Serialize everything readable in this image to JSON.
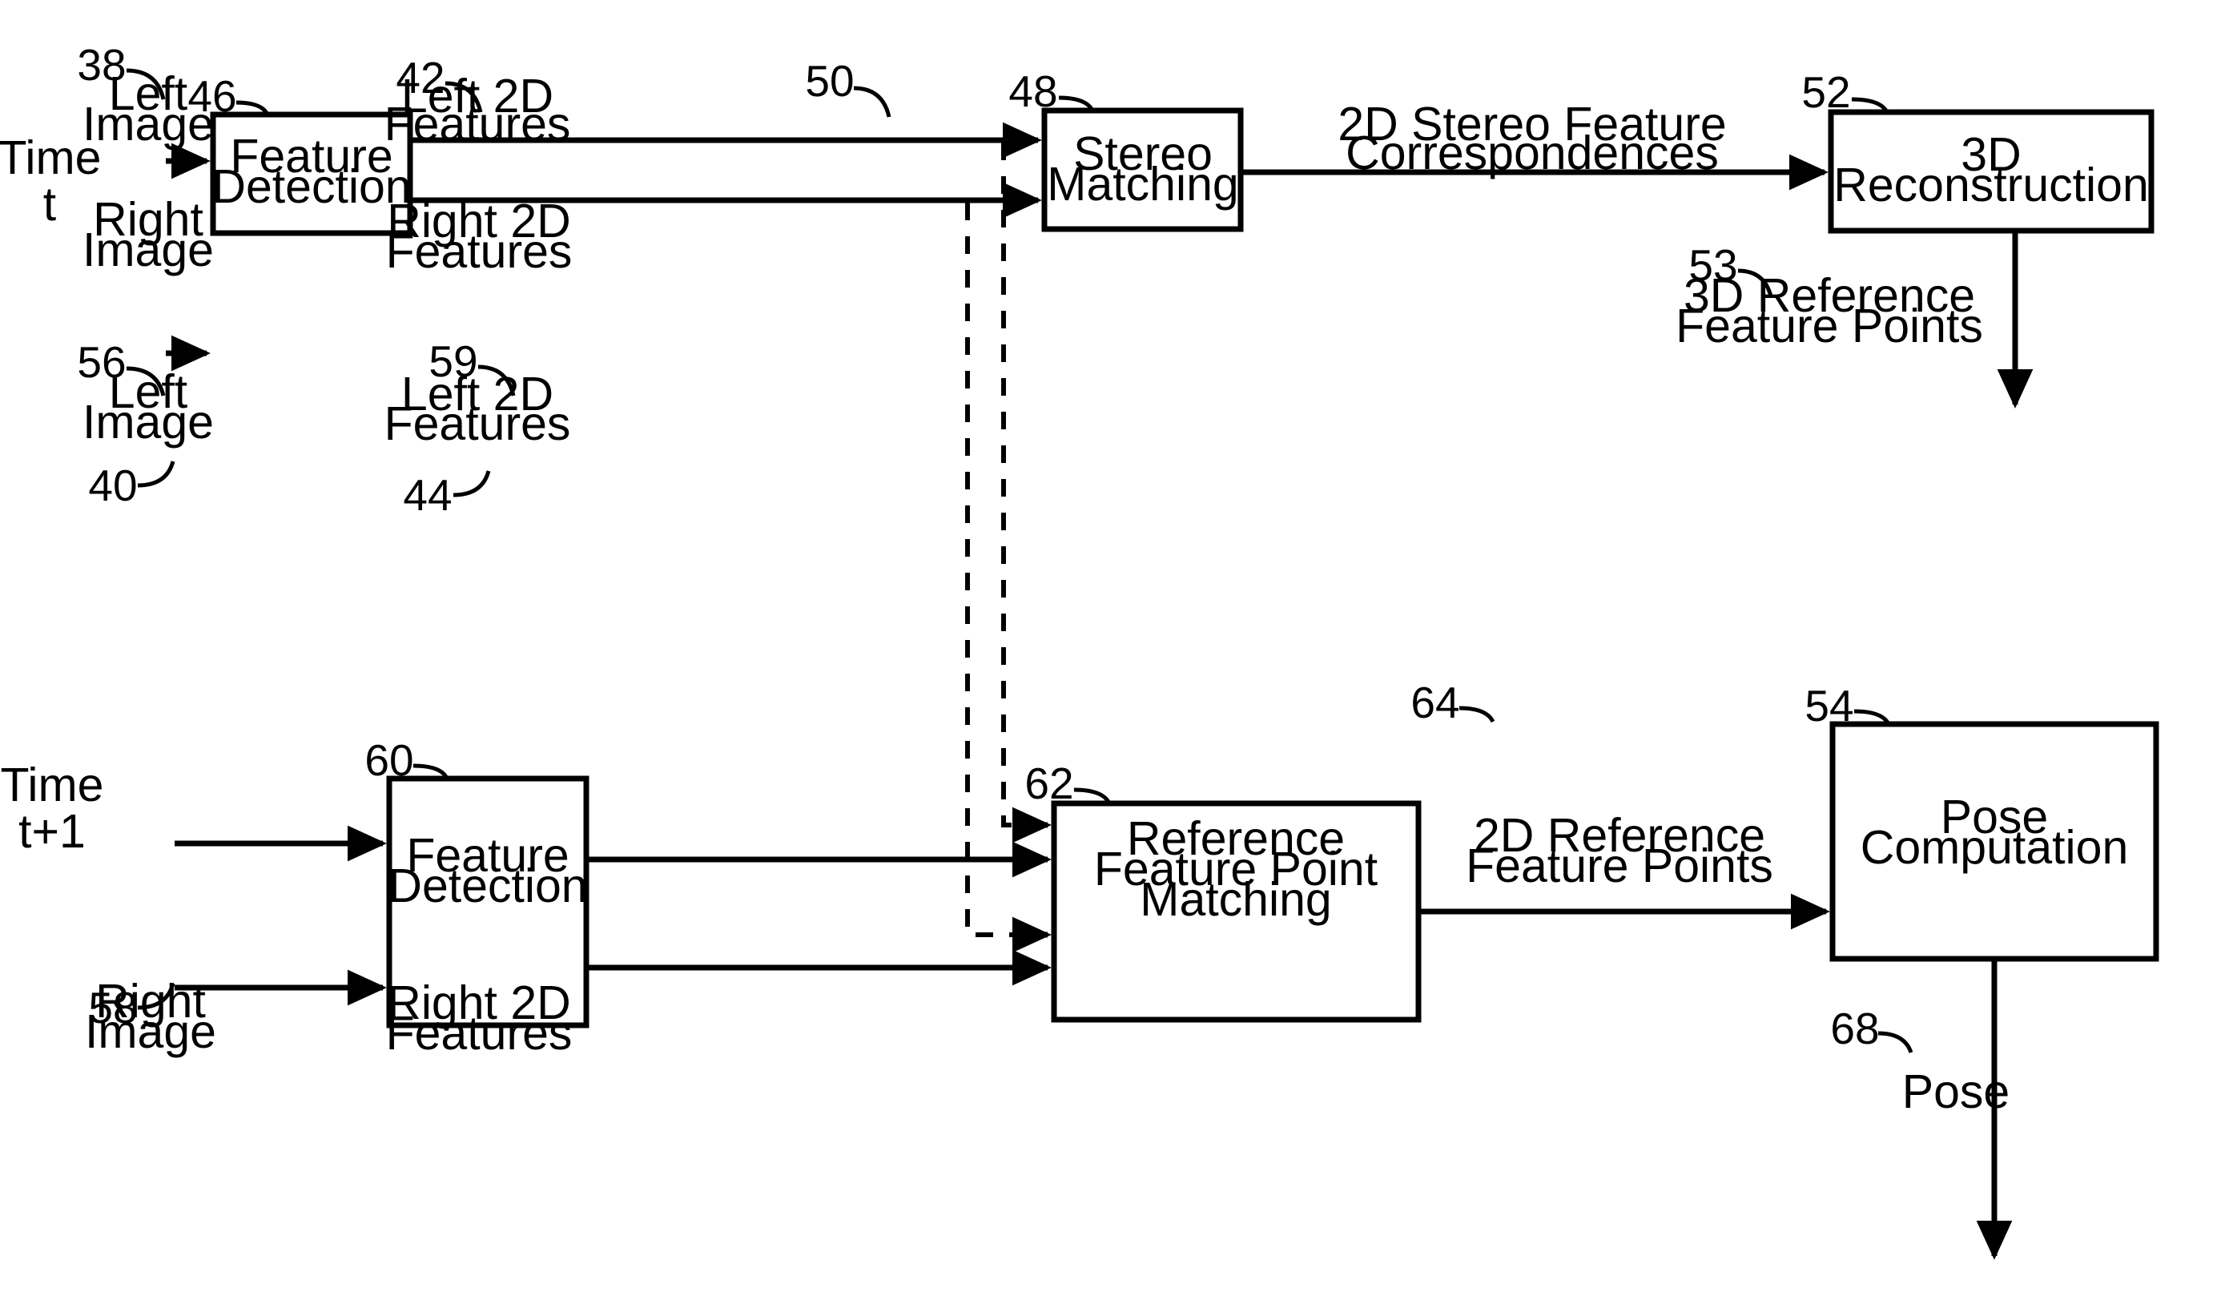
{
  "figure": {
    "kind": "patent-flow-diagram",
    "background_color": "#ffffff",
    "line_color": "#000000"
  },
  "boxes": {
    "feature_detection_t": {
      "ref": "46",
      "line1": "Feature",
      "line2": "Detection"
    },
    "stereo_matching": {
      "ref": "48",
      "line1": "Stereo",
      "line2": "Matching"
    },
    "reconstruction_3d": {
      "ref": "52",
      "line1": "3D",
      "line2": "Reconstruction"
    },
    "feature_detection_t1": {
      "ref": "60",
      "line1": "Feature",
      "line2": "Detection"
    },
    "reference_matching": {
      "ref": "62",
      "line1": "Reference",
      "line2": "Feature Point",
      "line3": "Matching"
    },
    "pose_computation": {
      "ref": "54",
      "line1": "Pose",
      "line2": "Computation"
    }
  },
  "time_labels": {
    "top": {
      "line1": "Time",
      "line2": "t"
    },
    "bottom": {
      "line1": "Time",
      "line2": "t+1"
    }
  },
  "flow_labels": {
    "left_image_t": {
      "ref": "38",
      "line1": "Left",
      "line2": "Image"
    },
    "right_image_t": {
      "ref": "40",
      "line1": "Right",
      "line2": "Image"
    },
    "left_2d_features_t": {
      "ref": "42",
      "line1": "Left 2D",
      "line2": "Features"
    },
    "right_2d_features_t": {
      "ref": "44",
      "line1": "Right 2D",
      "line2": "Features"
    },
    "stereo_correspondences": {
      "ref": "50",
      "line1": "2D Stereo Feature",
      "line2": "Correspondences"
    },
    "reference_points_3d": {
      "ref": "53",
      "line1": "3D Reference",
      "line2": "Feature Points"
    },
    "left_image_t1": {
      "ref": "56",
      "line1": "Left",
      "line2": "Image"
    },
    "right_image_t1": {
      "ref": "58",
      "line1": "Right",
      "line2": "Image"
    },
    "left_2d_features_t1": {
      "ref": "59",
      "line1": "Left 2D",
      "line2": "Features"
    },
    "right_2d_features_t1": {
      "line1": "Right 2D",
      "line2": "Features"
    },
    "reference_points_2d": {
      "ref": "64",
      "line1": "2D Reference",
      "line2": "Feature Points"
    },
    "pose_output": {
      "ref": "68",
      "line1": "Pose"
    }
  }
}
